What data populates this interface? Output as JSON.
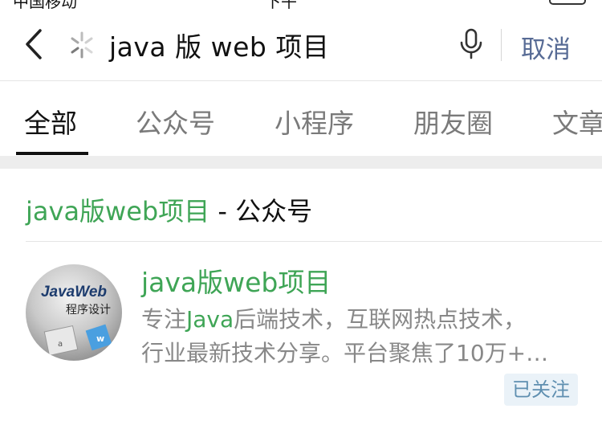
{
  "status_bar": {
    "carrier": "中国移动",
    "time": "下午",
    "battery": ""
  },
  "search": {
    "query": "java 版 web 项目",
    "cancel_label": "取消"
  },
  "tabs": [
    {
      "label": "全部"
    },
    {
      "label": "公众号"
    },
    {
      "label": "小程序"
    },
    {
      "label": "朋友圈"
    },
    {
      "label": "文章"
    }
  ],
  "section": {
    "keyword": "java版web项目",
    "suffix": " - 公众号"
  },
  "account": {
    "name": "java版web项目",
    "desc_prefix": "专注",
    "desc_highlight": "Java",
    "desc_rest1": "后端技术，互联网热点技术，",
    "desc_line2": "行业最新技术分享。平台聚焦了10万+…",
    "follow_label": "已关注",
    "avatar_text1": "JavaWeb",
    "avatar_text2": "程序设计"
  },
  "colors": {
    "accent_green": "#3fa556",
    "link_blue": "#576b95",
    "badge_bg": "#eaf2f8"
  }
}
